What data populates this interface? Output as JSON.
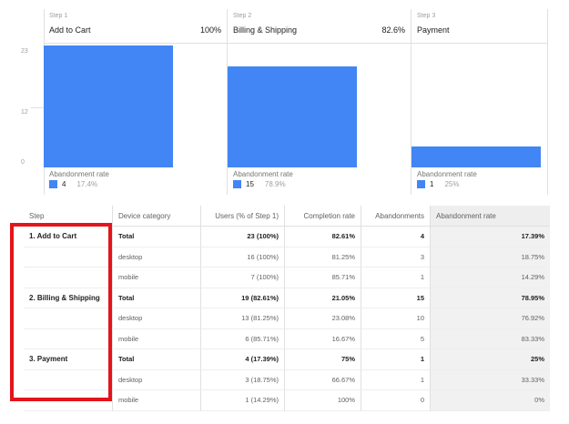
{
  "chart_data": {
    "type": "bar",
    "y_ticks": [
      "23",
      "12",
      "0"
    ],
    "ylim": [
      0,
      23
    ],
    "steps": [
      {
        "step": "Step 1",
        "name": "Add to Cart",
        "pct": "100%",
        "value": 23,
        "abandon_label": "Abandonment rate",
        "abandon_count": "4",
        "abandon_rate": "17.4%"
      },
      {
        "step": "Step 2",
        "name": "Billing & Shipping",
        "pct": "82.6%",
        "value": 19,
        "abandon_label": "Abandonment rate",
        "abandon_count": "15",
        "abandon_rate": "78.9%"
      },
      {
        "step": "Step 3",
        "name": "Payment",
        "pct": "",
        "value": 4,
        "abandon_label": "Abandonment rate",
        "abandon_count": "1",
        "abandon_rate": "25%"
      }
    ]
  },
  "table": {
    "headers": [
      "Step",
      "Device category",
      "Users (% of Step 1)",
      "Completion rate",
      "Abandonments",
      "Abandonment rate"
    ],
    "rows": [
      {
        "step": "1. Add to Cart",
        "device": "Total",
        "users": "23 (100%)",
        "completion": "82.61%",
        "abandonments": "4",
        "abandon_rate": "17.39%",
        "total": true
      },
      {
        "step": "",
        "device": "desktop",
        "users": "16 (100%)",
        "completion": "81.25%",
        "abandonments": "3",
        "abandon_rate": "18.75%",
        "total": false
      },
      {
        "step": "",
        "device": "mobile",
        "users": "7 (100%)",
        "completion": "85.71%",
        "abandonments": "1",
        "abandon_rate": "14.29%",
        "total": false
      },
      {
        "step": "2. Billing & Shipping",
        "device": "Total",
        "users": "19 (82.61%)",
        "completion": "21.05%",
        "abandonments": "15",
        "abandon_rate": "78.95%",
        "total": true
      },
      {
        "step": "",
        "device": "desktop",
        "users": "13 (81.25%)",
        "completion": "23.08%",
        "abandonments": "10",
        "abandon_rate": "76.92%",
        "total": false
      },
      {
        "step": "",
        "device": "mobile",
        "users": "6 (85.71%)",
        "completion": "16.67%",
        "abandonments": "5",
        "abandon_rate": "83.33%",
        "total": false
      },
      {
        "step": "3. Payment",
        "device": "Total",
        "users": "4 (17.39%)",
        "completion": "75%",
        "abandonments": "1",
        "abandon_rate": "25%",
        "total": true
      },
      {
        "step": "",
        "device": "desktop",
        "users": "3 (18.75%)",
        "completion": "66.67%",
        "abandonments": "1",
        "abandon_rate": "33.33%",
        "total": false
      },
      {
        "step": "",
        "device": "mobile",
        "users": "1 (14.29%)",
        "completion": "100%",
        "abandonments": "0",
        "abandon_rate": "0%",
        "total": false
      }
    ]
  },
  "colors": {
    "bar": "#4285f4",
    "highlight": "#e3141b"
  }
}
